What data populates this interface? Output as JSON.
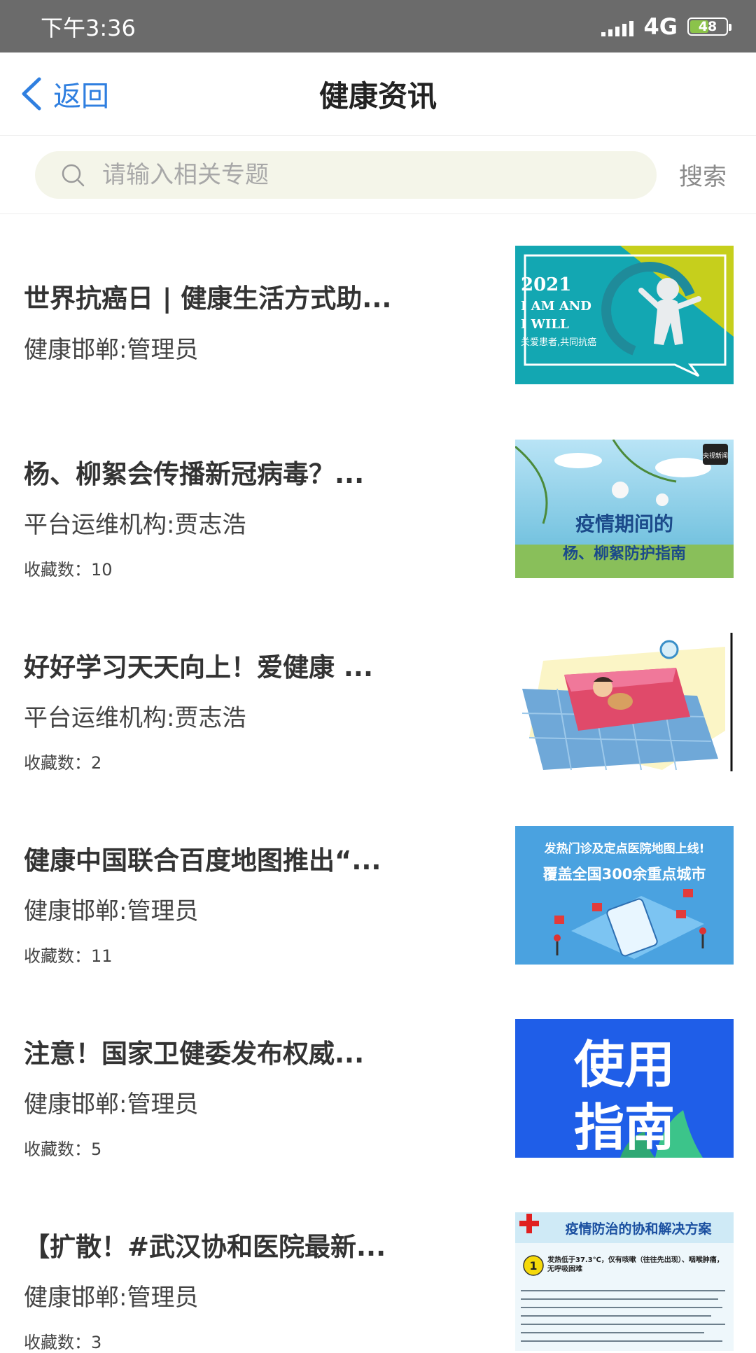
{
  "status_bar": {
    "time": "下午3:36",
    "network": "4G",
    "battery": "48"
  },
  "nav": {
    "back_label": "返回",
    "title": "健康资讯"
  },
  "search": {
    "placeholder": "请输入相关专题",
    "button_label": "搜索"
  },
  "articles": [
    {
      "title": "世界抗癌日 | 健康生活方式助...",
      "author": "健康邯郸:管理员",
      "favorites": "",
      "thumb": {
        "line1": "2021",
        "line2": "I AM AND",
        "line3": "I WILL",
        "line4": "关爱患者,共同抗癌"
      }
    },
    {
      "title": "杨、柳絮会传播新冠病毒？...",
      "author": "平台运维机构:贾志浩",
      "favorites": "收藏数：10",
      "thumb": {
        "line1": "疫情期间的",
        "line2": "杨、柳絮防护指南",
        "badge": "央视新闻"
      }
    },
    {
      "title": "好好学习天天向上！爱健康 ...",
      "author": "平台运维机构:贾志浩",
      "favorites": "收藏数：2",
      "thumb": {}
    },
    {
      "title": "健康中国联合百度地图推出“...",
      "author": "健康邯郸:管理员",
      "favorites": "收藏数：11",
      "thumb": {
        "line1": "发热门诊及定点医院地图上线!",
        "line2": "覆盖全国300余重点城市"
      }
    },
    {
      "title": "注意！国家卫健委发布权威...",
      "author": "健康邯郸:管理员",
      "favorites": "收藏数：5",
      "thumb": {
        "line1": "使用",
        "line2": "指南"
      }
    },
    {
      "title": "【扩散！#武汉协和医院最新...",
      "author": "健康邯郸:管理员",
      "favorites": "收藏数：3",
      "thumb": {
        "line1": "疫情防治的协和解决方案",
        "line2": "发热低于37.3℃，仅有咳嗽（往往先出现）、咽喉肿痛，无呼吸困难"
      }
    }
  ],
  "colors": {
    "accent": "#2f7fe0",
    "status_bar_bg": "#6b6b6b",
    "search_bg": "#f4f5e9"
  }
}
